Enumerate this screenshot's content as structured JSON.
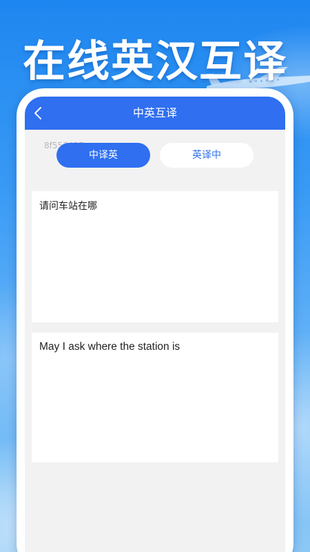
{
  "hero": {
    "title": "在线英汉互译"
  },
  "navbar": {
    "title": "中英互译",
    "back_icon": "chevron-left-icon"
  },
  "watermark": "8f553437",
  "tabs": [
    {
      "label": "中译英",
      "active": true
    },
    {
      "label": "英译中",
      "active": false
    }
  ],
  "source": {
    "text": "请问车站在哪"
  },
  "result": {
    "text": "May I ask where the station is"
  },
  "colors": {
    "accent": "#2f6ff0",
    "background_top": "#1e86f0",
    "panel": "#ffffff",
    "screen_bg": "#f2f2f2"
  }
}
